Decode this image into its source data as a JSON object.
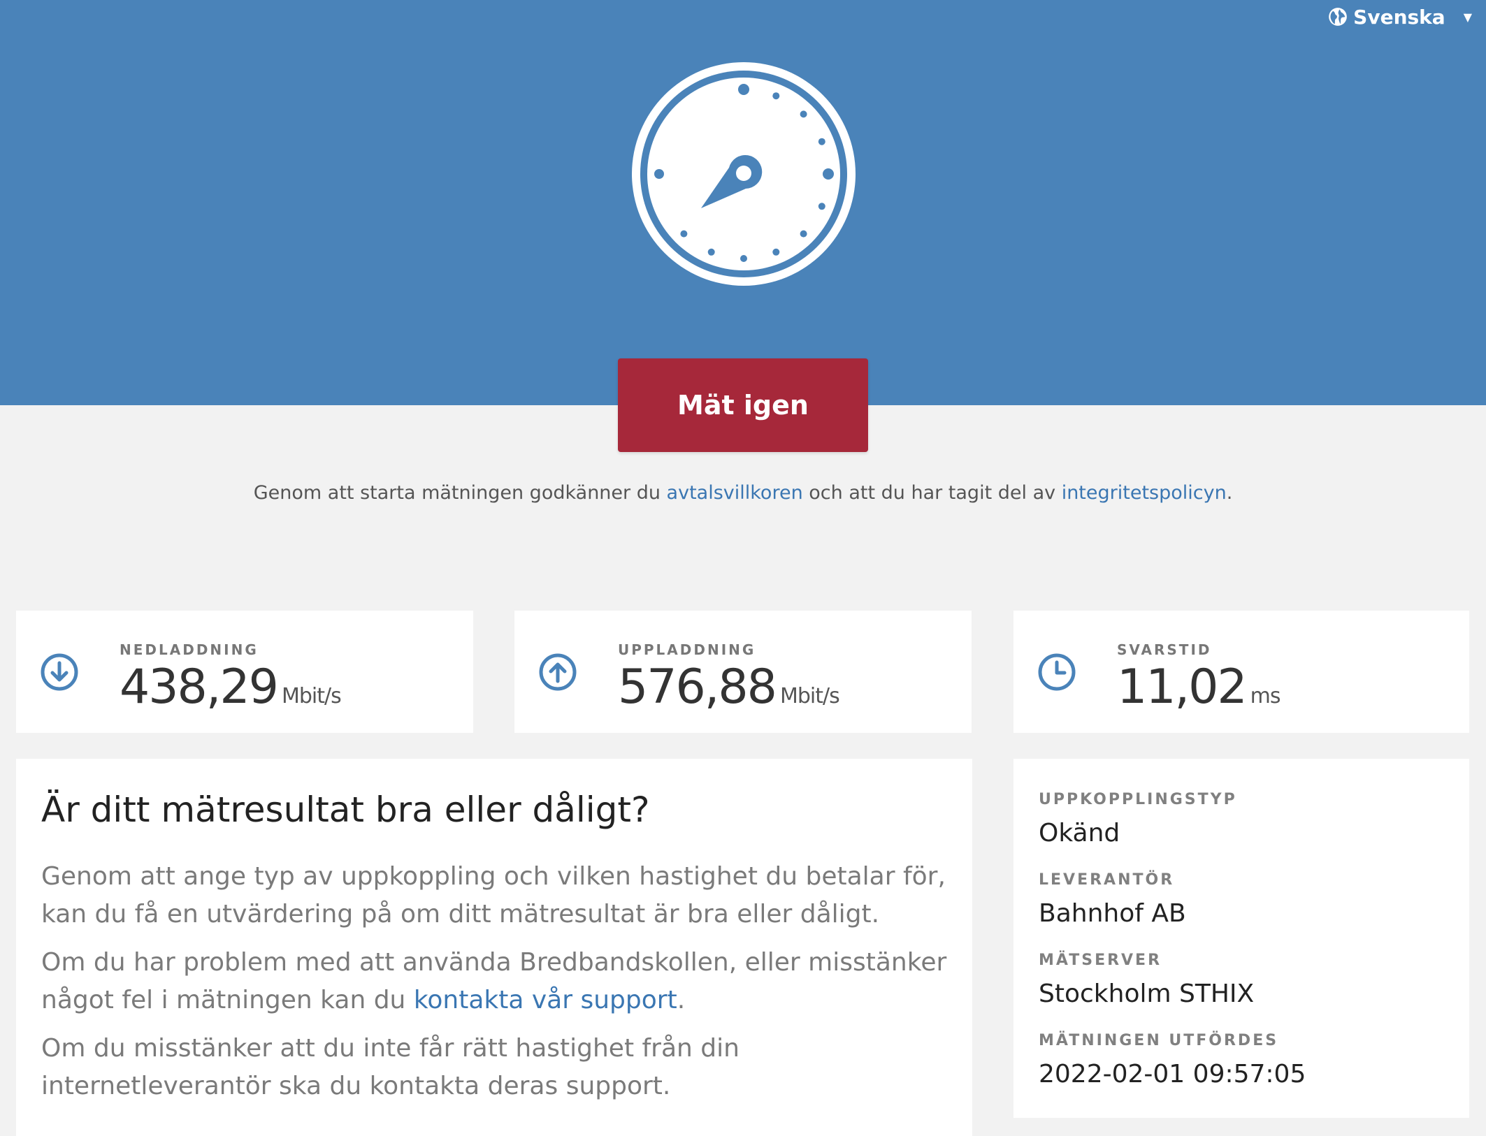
{
  "header": {
    "language": "Svenska"
  },
  "measure_button": "Mät igen",
  "consent": {
    "before": "Genom att starta mätningen godkänner du ",
    "terms_link": "avtalsvillkoren",
    "middle": " och att du har tagit del av ",
    "privacy_link": "integritetspolicyn",
    "after": "."
  },
  "metrics": {
    "download": {
      "label": "NEDLADDNING",
      "value": "438,29",
      "unit": "Mbit/s"
    },
    "upload": {
      "label": "UPPLADDNING",
      "value": "576,88",
      "unit": "Mbit/s"
    },
    "latency": {
      "label": "SVARSTID",
      "value": "11,02",
      "unit": "ms"
    }
  },
  "info": {
    "title": "Är ditt mätresultat bra eller dåligt?",
    "p1": "Genom att ange typ av uppkoppling och vilken hastighet du betalar för, kan du få en utvärdering på om ditt mätresultat är bra eller dåligt.",
    "p2_before": "Om du har problem med att använda Bredbandskollen, eller misstänker något fel i mätningen kan du ",
    "p2_link": "kontakta vår support",
    "p2_after": ".",
    "p3": "Om du misstänker att du inte får rätt hastighet från din internetleverantör ska du kontakta deras support."
  },
  "details": {
    "connection_type_label": "UPPKOPPLINGSTYP",
    "connection_type": "Okänd",
    "provider_label": "LEVERANTÖR",
    "provider": "Bahnhof AB",
    "server_label": "MÄTSERVER",
    "server": "Stockholm STHIX",
    "performed_label": "MÄTNINGEN UTFÖRDES",
    "performed": "2022-02-01 09:57:05"
  },
  "colors": {
    "hero": "#4a83b9",
    "button": "#a6283a",
    "link": "#3a76b2",
    "icon": "#4a83b9"
  }
}
